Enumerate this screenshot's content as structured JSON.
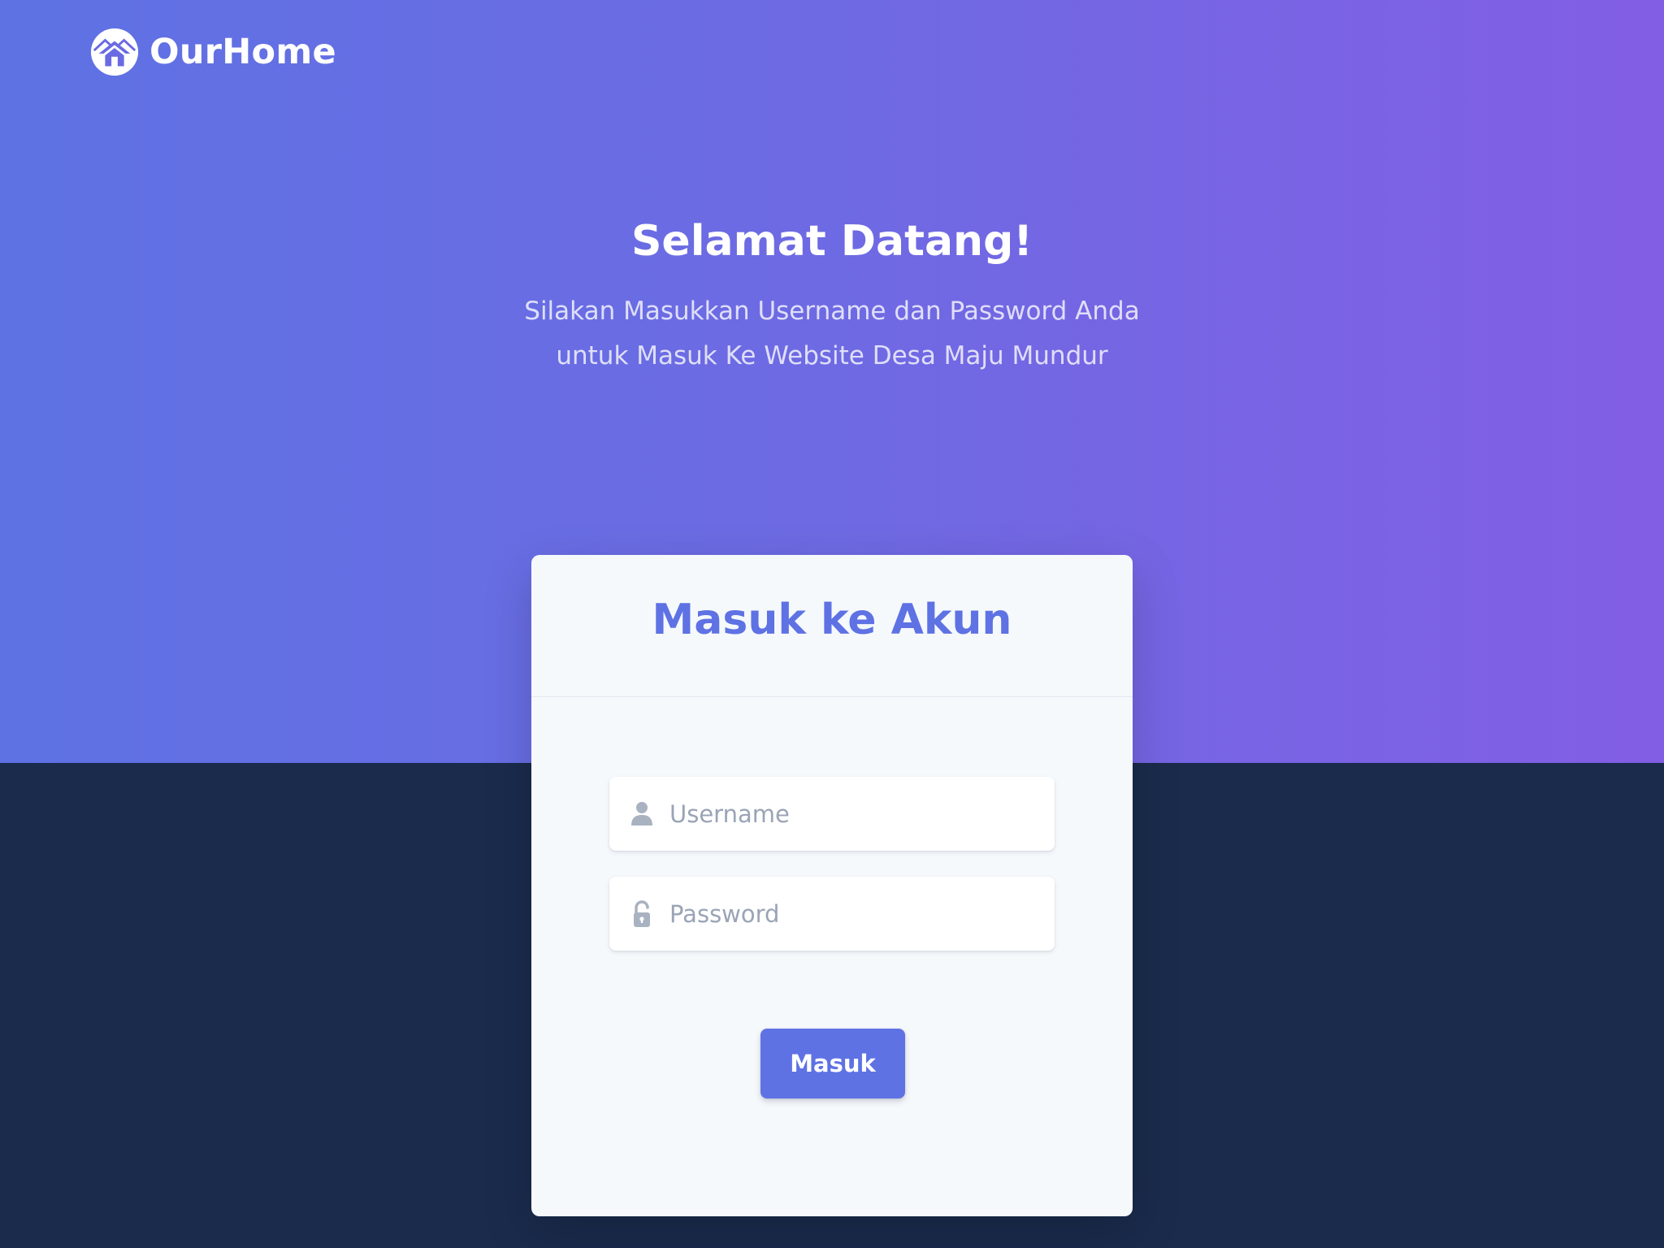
{
  "brand": {
    "name": "OurHome",
    "logo_icon": "house-globe-icon"
  },
  "hero": {
    "title": "Selamat Datang!",
    "subtitle": "Silakan Masukkan Username dan Password Anda untuk Masuk Ke Website Desa Maju Mundur"
  },
  "login": {
    "title": "Masuk ke Akun",
    "username": {
      "placeholder": "Username",
      "value": "",
      "icon": "user-icon"
    },
    "password": {
      "placeholder": "Password",
      "value": "",
      "icon": "lock-open-icon"
    },
    "submit_label": "Masuk"
  },
  "colors": {
    "primary": "#5e72e4",
    "gradient_end": "#825ee4",
    "dark_bg": "#172b4d",
    "card_bg": "#f6f9fc"
  }
}
